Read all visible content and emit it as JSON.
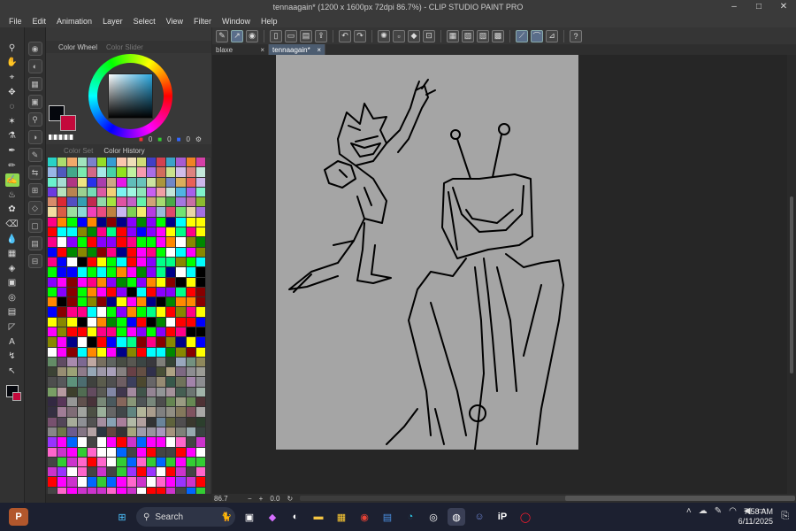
{
  "window": {
    "title": "tennaagain* (1200 x 1600px 72dpi 86.7%)  - CLIP STUDIO PAINT PRO",
    "controls": [
      "–",
      "□",
      "✕"
    ]
  },
  "menu": [
    "File",
    "Edit",
    "Animation",
    "Layer",
    "Select",
    "View",
    "Filter",
    "Window",
    "Help"
  ],
  "tabs": [
    {
      "label": "blaxe",
      "active": false
    },
    {
      "label": "tennaagain*",
      "active": true
    }
  ],
  "color_panel": {
    "tab_active": "Color Wheel",
    "tab_inactive": "Color Slider",
    "main_color": "#05070d",
    "sub_color": "#c4093c",
    "r": "0",
    "g": "0",
    "b": "0"
  },
  "palette_panel": {
    "tab_inactive": "Color Set",
    "tab_active": "Color History"
  },
  "canvas": {
    "zoom": "86.7",
    "angle": "0.0",
    "paper_color": "#a5a5a5"
  },
  "taskbar": {
    "search_label": "Search",
    "time": "7:58 AM",
    "date": "6/11/2025"
  }
}
